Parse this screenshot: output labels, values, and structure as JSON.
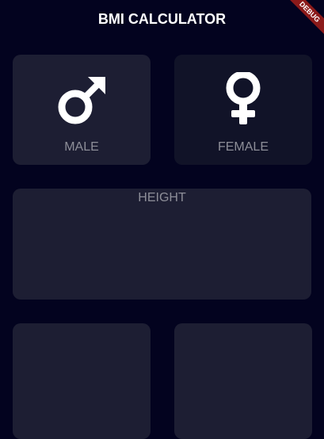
{
  "app": {
    "title": "BMI CALCULATOR",
    "debug_banner": "DEBUG"
  },
  "gender": {
    "male_label": "MALE",
    "female_label": "FEMALE",
    "selected": "male"
  },
  "height": {
    "label": "HEIGHT"
  },
  "colors": {
    "background": "#03031f",
    "active_card": "#1d1e33",
    "inactive_card": "#111328",
    "label": "#8d8e98"
  }
}
